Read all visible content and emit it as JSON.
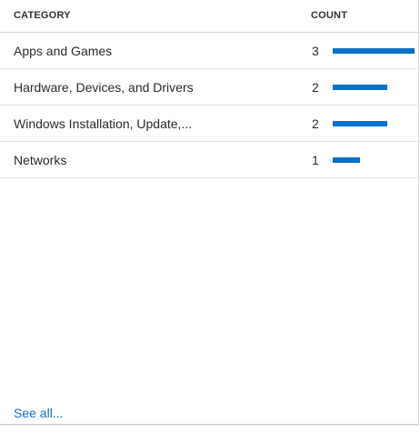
{
  "table": {
    "header": {
      "category": "CATEGORY",
      "count": "COUNT"
    },
    "max_count": 3,
    "bar_color": "#0a6fc6",
    "rows": [
      {
        "category": "Apps and Games",
        "count": "3",
        "value": 3
      },
      {
        "category": "Hardware, Devices, and Drivers",
        "count": "2",
        "value": 2
      },
      {
        "category": "Windows Installation, Update,...",
        "count": "2",
        "value": 2
      },
      {
        "category": "Networks",
        "count": "1",
        "value": 1
      }
    ]
  },
  "footer": {
    "see_all": "See all..."
  },
  "colors": {
    "link": "#1570c4",
    "divider": "#e1e1e1"
  }
}
